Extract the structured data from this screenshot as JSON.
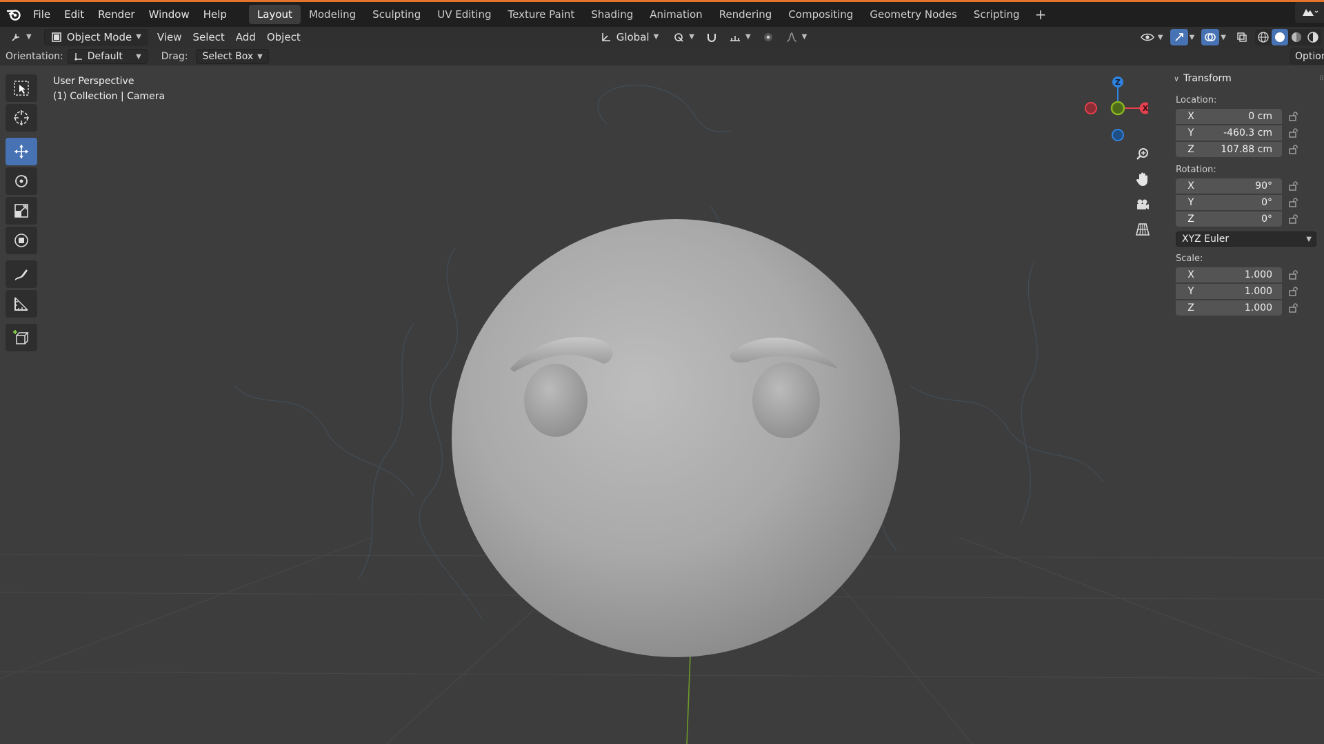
{
  "menubar": {
    "items": [
      "File",
      "Edit",
      "Render",
      "Window",
      "Help"
    ],
    "workspaces": [
      "Layout",
      "Modeling",
      "Sculpting",
      "UV Editing",
      "Texture Paint",
      "Shading",
      "Animation",
      "Rendering",
      "Compositing",
      "Geometry Nodes",
      "Scripting"
    ],
    "active_workspace": "Layout",
    "add_tab": "+"
  },
  "header": {
    "mode": "Object Mode",
    "menus": [
      "View",
      "Select",
      "Add",
      "Object"
    ],
    "transform_orientation": "Global"
  },
  "tool_header": {
    "orientation_label": "Orientation:",
    "orientation_value": "Default",
    "drag_label": "Drag:",
    "drag_value": "Select Box",
    "options_label": "Options"
  },
  "viewport": {
    "view_name": "User Perspective",
    "context": "(1) Collection | Camera"
  },
  "gizmo": {
    "z_label": "Z",
    "x_label": "X",
    "colors": {
      "x": "#e5404e",
      "y": "#8ab51d",
      "z": "#2f83e0"
    }
  },
  "npanel": {
    "section": "Transform",
    "location_label": "Location:",
    "location": [
      {
        "axis": "X",
        "value": "0 cm"
      },
      {
        "axis": "Y",
        "value": "-460.3 cm"
      },
      {
        "axis": "Z",
        "value": "107.88 cm"
      }
    ],
    "rotation_label": "Rotation:",
    "rotation": [
      {
        "axis": "X",
        "value": "90°"
      },
      {
        "axis": "Y",
        "value": "0°"
      },
      {
        "axis": "Z",
        "value": "0°"
      }
    ],
    "rotation_mode": "XYZ Euler",
    "scale_label": "Scale:",
    "scale": [
      {
        "axis": "X",
        "value": "1.000"
      },
      {
        "axis": "Y",
        "value": "1.000"
      },
      {
        "axis": "Z",
        "value": "1.000"
      }
    ]
  },
  "colors": {
    "accent": "#e3742a",
    "active_tool": "#4772b3"
  }
}
